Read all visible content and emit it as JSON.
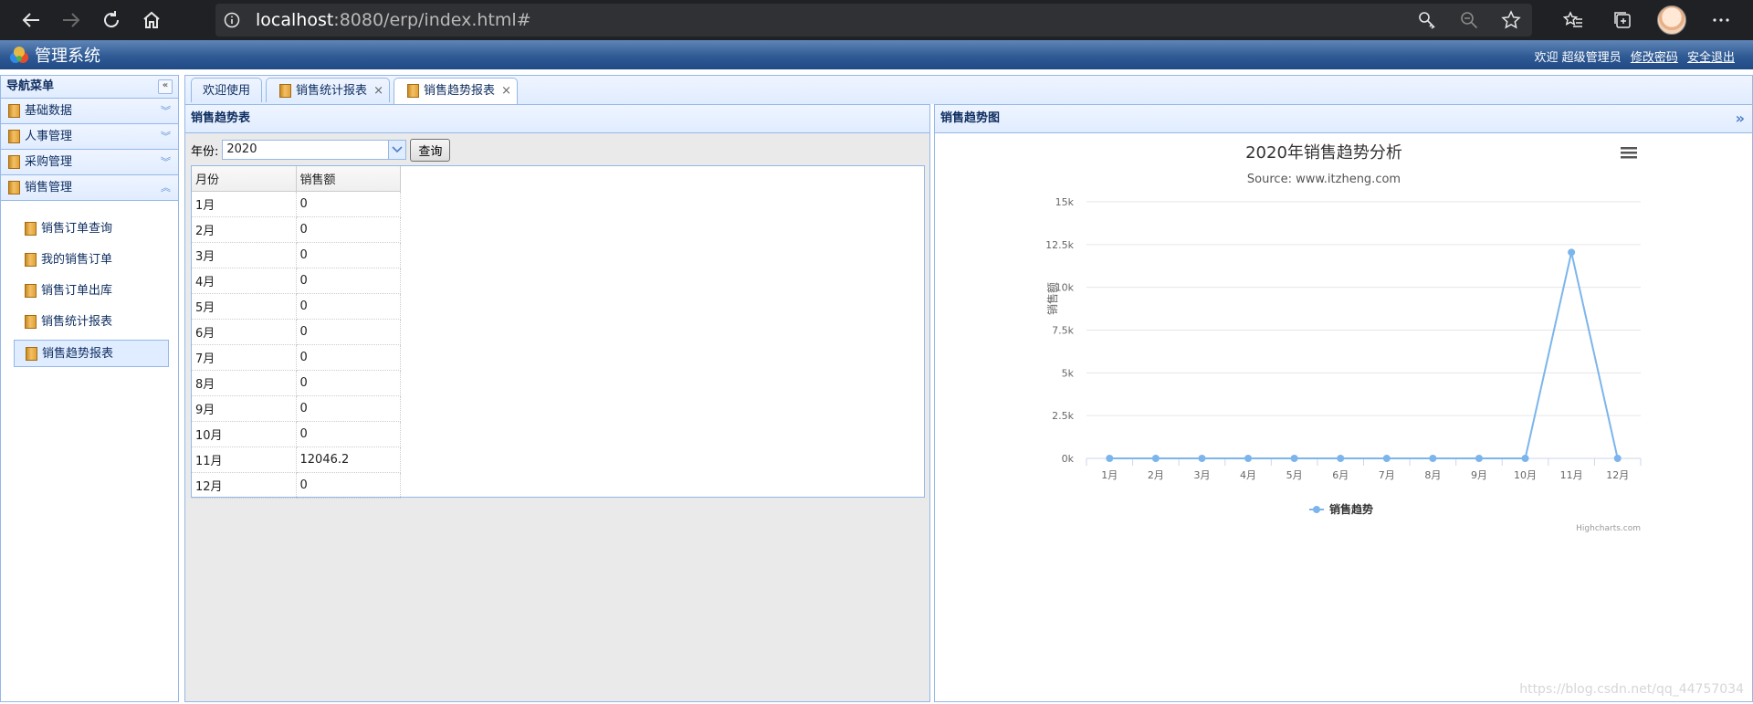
{
  "browser": {
    "url_host": "localhost",
    "url_rest": ":8080/erp/index.html#"
  },
  "app": {
    "title": "管理系统",
    "welcome": "欢迎 超级管理员",
    "change_password": "修改密码",
    "logout": "安全退出"
  },
  "sidebar": {
    "header": "导航菜单",
    "sections": [
      {
        "label": "基础数据"
      },
      {
        "label": "人事管理"
      },
      {
        "label": "采购管理"
      },
      {
        "label": "销售管理"
      }
    ],
    "sub_items": [
      {
        "label": "销售订单查询"
      },
      {
        "label": "我的销售订单"
      },
      {
        "label": "销售订单出库"
      },
      {
        "label": "销售统计报表"
      },
      {
        "label": "销售趋势报表"
      }
    ]
  },
  "tabs": [
    {
      "label": "欢迎使用"
    },
    {
      "label": "销售统计报表"
    },
    {
      "label": "销售趋势报表"
    }
  ],
  "left_panel": {
    "title": "销售趋势表",
    "year_label": "年份:",
    "year_value": "2020",
    "query_button": "查询",
    "columns": [
      "月份",
      "销售额"
    ],
    "rows": [
      [
        "1月",
        "0"
      ],
      [
        "2月",
        "0"
      ],
      [
        "3月",
        "0"
      ],
      [
        "4月",
        "0"
      ],
      [
        "5月",
        "0"
      ],
      [
        "6月",
        "0"
      ],
      [
        "7月",
        "0"
      ],
      [
        "8月",
        "0"
      ],
      [
        "9月",
        "0"
      ],
      [
        "10月",
        "0"
      ],
      [
        "11月",
        "12046.2"
      ],
      [
        "12月",
        "0"
      ]
    ]
  },
  "right_panel": {
    "title": "销售趋势图"
  },
  "chart_data": {
    "type": "line",
    "title": "2020年销售趋势分析",
    "subtitle": "Source: www.itzheng.com",
    "ylabel": "销售额",
    "xlabel": "",
    "categories": [
      "1月",
      "2月",
      "3月",
      "4月",
      "5月",
      "6月",
      "7月",
      "8月",
      "9月",
      "10月",
      "11月",
      "12月"
    ],
    "series": [
      {
        "name": "销售趋势",
        "values": [
          0,
          0,
          0,
          0,
          0,
          0,
          0,
          0,
          0,
          0,
          12046.2,
          0
        ]
      }
    ],
    "ylim": [
      0,
      15000
    ],
    "yticks": [
      "0k",
      "2.5k",
      "5k",
      "7.5k",
      "10k",
      "12.5k",
      "15k"
    ],
    "grid": true,
    "legend_position": "bottom",
    "credits": "Highcharts.com",
    "color": "#7cb5ec"
  },
  "watermark": "https://blog.csdn.net/qq_44757034"
}
